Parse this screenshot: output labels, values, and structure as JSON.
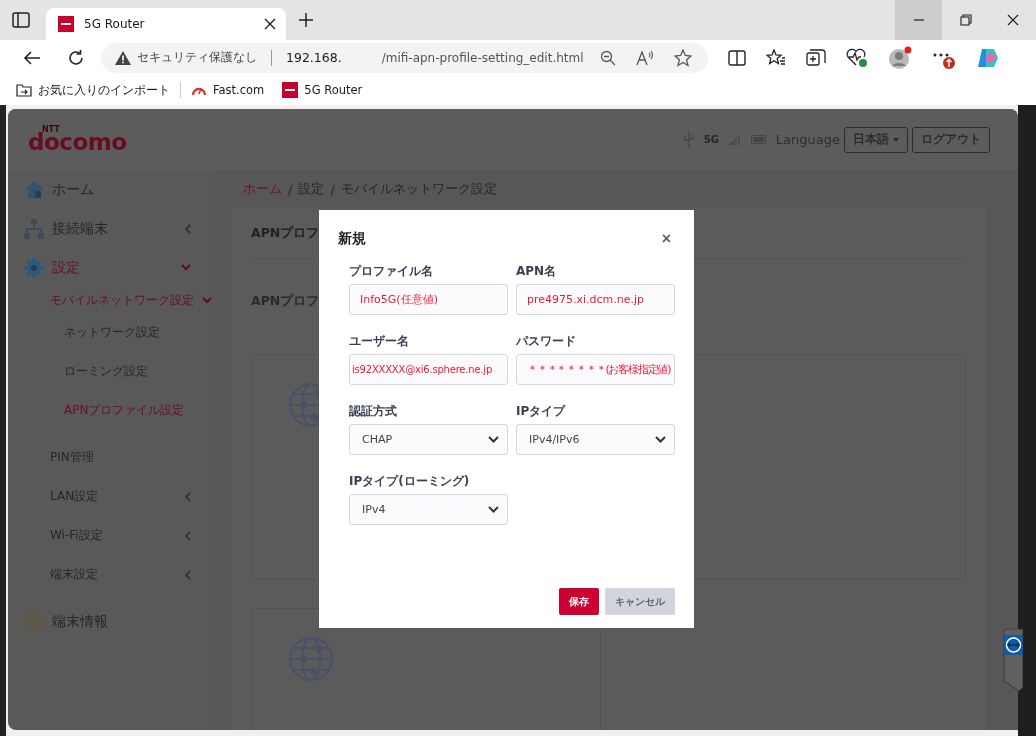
{
  "browser": {
    "tab_title": "5G Router",
    "address": {
      "security_label": "セキュリティ保護なし",
      "host": "192.168.",
      "path": "/mifi-apn-profile-setting_edit.html"
    },
    "bookmarks": [
      {
        "label": "お気に入りのインポート",
        "kind": "import"
      },
      {
        "label": "Fast.com",
        "kind": "gauge"
      },
      {
        "label": "5G Router",
        "kind": "site"
      }
    ]
  },
  "router": {
    "logo_mark": "NTT",
    "logo": "docomo",
    "network": "5G",
    "language_label": "Language",
    "language_button": "日本語",
    "logout_button": "ログアウト",
    "sidebar": [
      {
        "label": "ホーム",
        "selected": false
      },
      {
        "label": "接続端末",
        "selected": false,
        "expanded": false
      },
      {
        "label": "設定",
        "selected": true,
        "expanded": true,
        "children": [
          {
            "label": "モバイルネットワーク設定",
            "selected": true,
            "expanded": true,
            "children": [
              {
                "label": "ネットワーク設定",
                "selected": false
              },
              {
                "label": "ローミング設定",
                "selected": false
              },
              {
                "label": "APNプロファイル設定",
                "selected": true
              }
            ]
          },
          {
            "label": "PIN管理",
            "selected": false
          },
          {
            "label": "LAN設定",
            "selected": false,
            "expanded": false
          },
          {
            "label": "Wi-Fi設定",
            "selected": false,
            "expanded": false
          },
          {
            "label": "端末設定",
            "selected": false,
            "expanded": false
          }
        ]
      },
      {
        "label": "端末情報",
        "selected": false
      }
    ],
    "breadcrumb": [
      {
        "label": "ホーム",
        "kind": "link"
      },
      {
        "label": "/",
        "kind": "separator"
      },
      {
        "label": "設定",
        "kind": "text"
      },
      {
        "label": "/",
        "kind": "separator"
      },
      {
        "label": "モバイルネットワーク設定",
        "kind": "text"
      }
    ],
    "panel_title": "APNプロフ",
    "section_title": "APNプロフ"
  },
  "dialog": {
    "title": "新規",
    "close": "×",
    "fields": [
      {
        "label": "プロファイル名",
        "kind": "text",
        "value": "Info5G(任意値)"
      },
      {
        "label": "APN名",
        "kind": "text",
        "value": "pre4975.xi.dcm.ne.jp"
      },
      {
        "label": "ユーザー名",
        "kind": "text",
        "value": "is92XXXXX@xi6.sphere.ne.jp"
      },
      {
        "label": "パスワード",
        "kind": "text",
        "value": "＊＊＊＊＊＊＊＊(お客様指定値)"
      },
      {
        "label": "認証方式",
        "kind": "select",
        "value": "CHAP"
      },
      {
        "label": "IPタイプ",
        "kind": "select",
        "value": "IPv4/IPv6"
      },
      {
        "label": "IPタイプ(ローミング)",
        "kind": "select",
        "value": "IPv4"
      }
    ],
    "buttons": [
      {
        "label": "保存",
        "kind": "primary",
        "disabled": false
      },
      {
        "label": "キャンセル",
        "kind": "secondary",
        "disabled": true
      }
    ]
  }
}
